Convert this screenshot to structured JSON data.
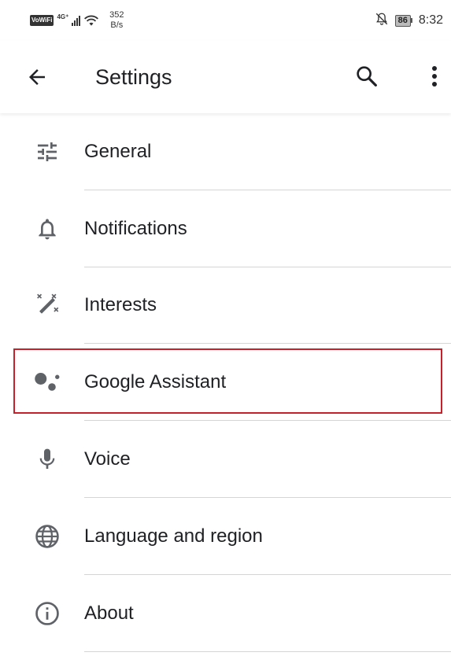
{
  "status_bar": {
    "vowifi": "VoWiFi",
    "network": "4G⁺",
    "speed_value": "352",
    "speed_unit": "B/s",
    "battery": "86",
    "time": "8:32"
  },
  "app_bar": {
    "title": "Settings"
  },
  "menu": {
    "items": [
      {
        "label": "General",
        "icon": "tune-icon"
      },
      {
        "label": "Notifications",
        "icon": "bell-icon"
      },
      {
        "label": "Interests",
        "icon": "magic-wand-icon"
      },
      {
        "label": "Google Assistant",
        "icon": "google-assistant-icon"
      },
      {
        "label": "Voice",
        "icon": "microphone-icon"
      },
      {
        "label": "Language and region",
        "icon": "globe-icon"
      },
      {
        "label": "About",
        "icon": "info-icon"
      }
    ]
  },
  "colors": {
    "highlight_border": "#c8202a",
    "icon_color": "#5f6368",
    "text_color": "#202124"
  }
}
